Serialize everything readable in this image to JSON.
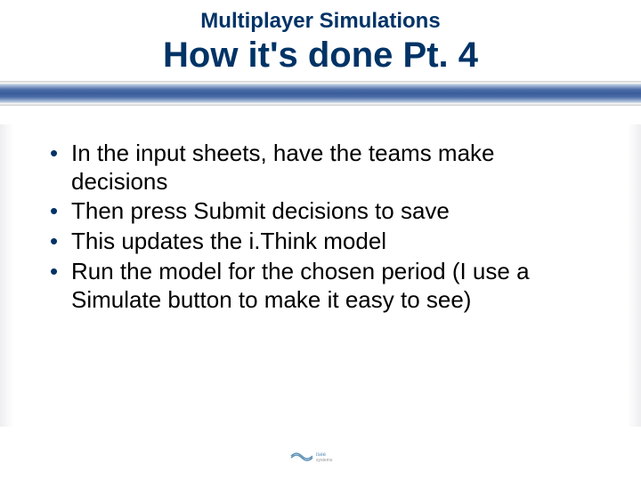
{
  "header": {
    "subtitle": "Multiplayer Simulations",
    "title": "How it's done Pt. 4"
  },
  "bullets": [
    "In the input sheets, have the teams make decisions",
    "Then press Submit decisions to save",
    "This updates the i.Think model",
    "Run the model for the chosen period (I use a Simulate button to make it easy to see)"
  ],
  "footer": {
    "logo_text": "isee systems"
  },
  "colors": {
    "heading": "#003366",
    "accent_bar": "#4a6ca8"
  }
}
